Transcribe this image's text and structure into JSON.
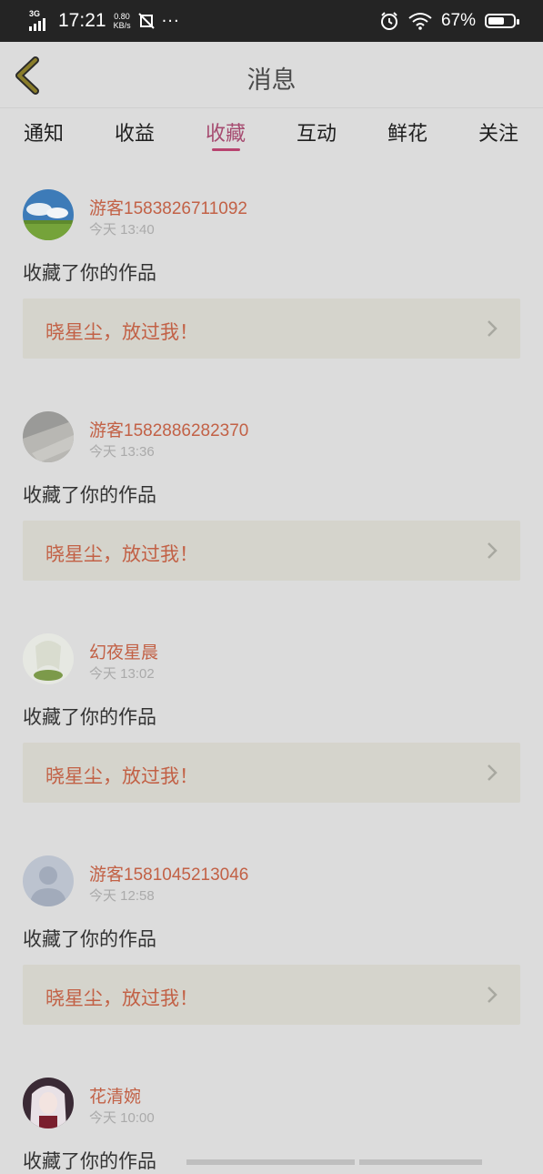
{
  "status_bar": {
    "network": "3G",
    "time": "17:21",
    "speed_value": "0.80",
    "speed_unit": "KB/s",
    "more": "···",
    "battery_pct": "67%",
    "battery_level": 0.67
  },
  "header": {
    "title": "消息"
  },
  "tabs": [
    {
      "label": "通知"
    },
    {
      "label": "收益"
    },
    {
      "label": "收藏",
      "active": true
    },
    {
      "label": "互动"
    },
    {
      "label": "鲜花"
    },
    {
      "label": "关注"
    }
  ],
  "messages": [
    {
      "name": "游客1583826711092",
      "time": "今天 13:40",
      "action": "收藏了你的作品",
      "work": "晓星尘，放过我！",
      "avatar": "landscape-avatar"
    },
    {
      "name": "游客1582886282370",
      "time": "今天 13:36",
      "action": "收藏了你的作品",
      "work": "晓星尘，放过我！",
      "avatar": "grey-photo-avatar"
    },
    {
      "name": "幻夜星晨",
      "time": "今天 13:02",
      "action": "收藏了你的作品",
      "work": "晓星尘，放过我！",
      "avatar": "anime-avatar"
    },
    {
      "name": "游客1581045213046",
      "time": "今天 12:58",
      "action": "收藏了你的作品",
      "work": "晓星尘，放过我！",
      "avatar": "default-user-avatar"
    },
    {
      "name": "花清婉",
      "time": "今天 10:00",
      "action": "收藏了你的作品",
      "work": "",
      "avatar": "anime-girl-avatar"
    }
  ],
  "colors": {
    "accent": "#b8436f",
    "username": "#c26146",
    "overlay_bg": "#dcdcdc"
  }
}
